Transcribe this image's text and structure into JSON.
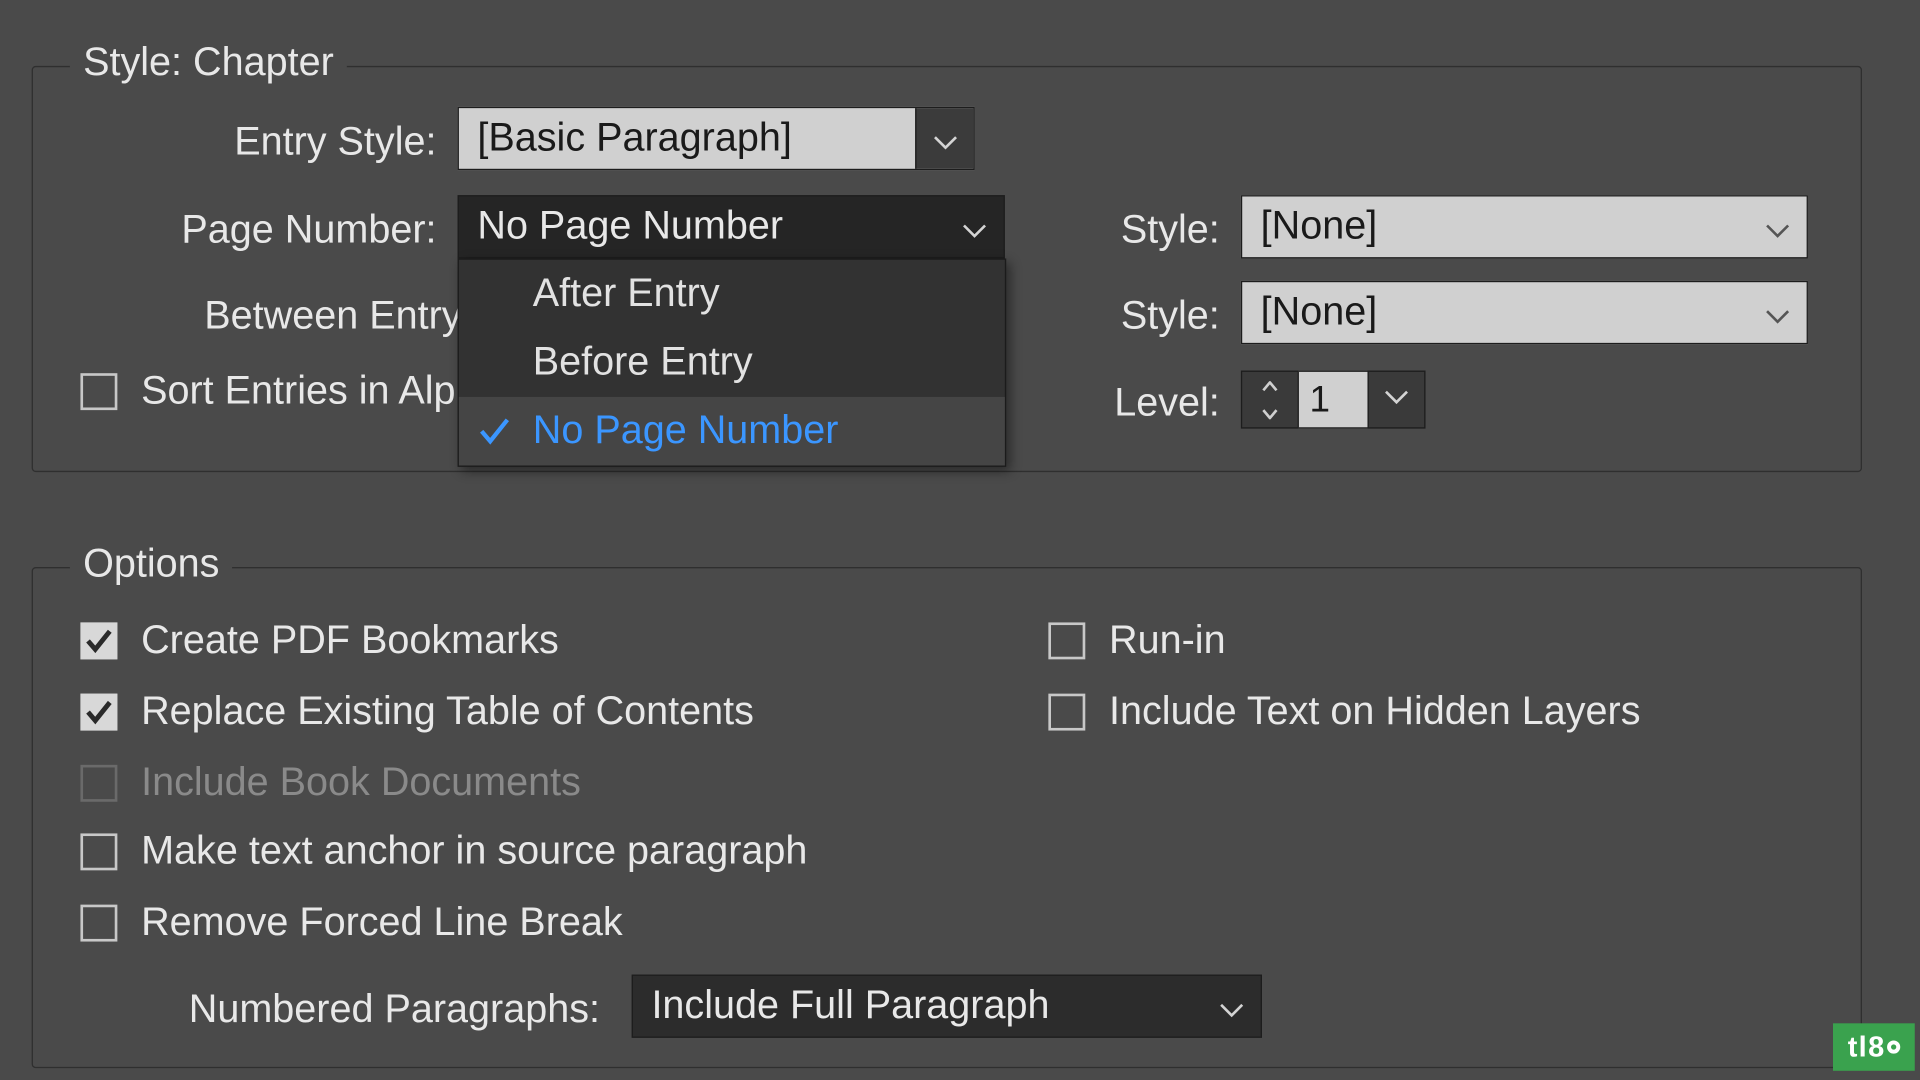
{
  "top": {
    "legend": "Style: Chapter",
    "entry_style_label": "Entry Style:",
    "entry_style_value": "[Basic Paragraph]",
    "page_number_label": "Page Number:",
    "page_number_value": "No Page Number",
    "page_number_options": [
      "After Entry",
      "Before Entry",
      "No Page Number"
    ],
    "page_number_selected_index": 2,
    "between_entry_label": "Between Entry",
    "sort_alpha_label": "Sort Entries in Alp",
    "style1_label": "Style:",
    "style1_value": "[None]",
    "style2_label": "Style:",
    "style2_value": "[None]",
    "level_label": "Level:",
    "level_value": "1"
  },
  "options": {
    "legend": "Options",
    "create_pdf": {
      "label": "Create PDF Bookmarks",
      "checked": true
    },
    "replace_toc": {
      "label": "Replace Existing Table of Contents",
      "checked": true
    },
    "include_book": {
      "label": "Include Book Documents",
      "checked": false,
      "disabled": true
    },
    "anchor": {
      "label": "Make text anchor in source paragraph",
      "checked": false
    },
    "remove_break": {
      "label": "Remove Forced Line Break",
      "checked": false
    },
    "runin": {
      "label": "Run-in",
      "checked": false
    },
    "hidden_layers": {
      "label": "Include Text on Hidden Layers",
      "checked": false
    },
    "numbered_label": "Numbered Paragraphs:",
    "numbered_value": "Include Full Paragraph"
  },
  "watermark": "tl80"
}
